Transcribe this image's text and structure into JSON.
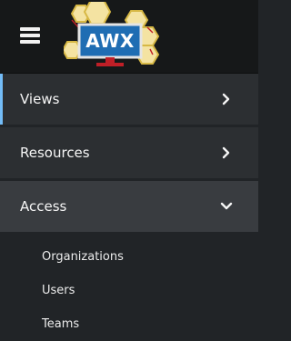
{
  "header": {
    "menu_icon": "hamburger-icon",
    "logo_text": "AWX",
    "logo_colors": {
      "hex_fill": "#f4e3a2",
      "hex_stroke": "#d7b845",
      "screen": "#1f6db3",
      "screen_border": "#e4e4e4",
      "stand": "#c01f27"
    }
  },
  "nav": {
    "items": [
      {
        "label": "Views",
        "chevron": "chevron-right-icon",
        "expanded": false
      },
      {
        "label": "Resources",
        "chevron": "chevron-right-icon",
        "expanded": false
      },
      {
        "label": "Access",
        "chevron": "chevron-down-icon",
        "expanded": true
      }
    ],
    "access_children": [
      {
        "label": "Organizations"
      },
      {
        "label": "Users"
      },
      {
        "label": "Teams"
      }
    ]
  },
  "colors": {
    "header_bg": "#161819",
    "sidebar_bg": "#212427",
    "item_bg": "#2c2f32",
    "item_active_bg": "#393c40",
    "selected_accent": "#73bcf7",
    "text": "#f5f5f5"
  }
}
